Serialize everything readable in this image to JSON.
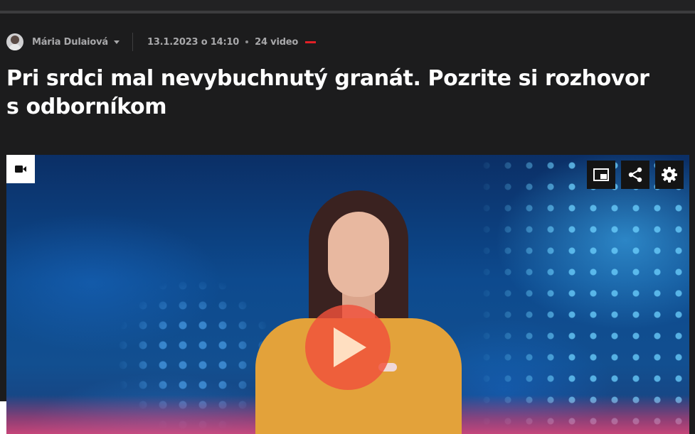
{
  "colors": {
    "background": "#1c1c1d",
    "headline": "#ffffff",
    "meta_text": "#a8a8aa",
    "accent_red": "#e12026",
    "play_button": "#f0503c"
  },
  "meta": {
    "author": "Mária Dulaiová",
    "date": "13.1.2023 o 14:10",
    "video_count": "24 video"
  },
  "article": {
    "title": "Pri srdci mal nevybuchnutý granát. Pozrite si rozhovor s odborníkom"
  },
  "player": {
    "badge_icon": "video-camera-icon",
    "controls": [
      {
        "icon": "picture-in-picture-icon"
      },
      {
        "icon": "share-icon"
      },
      {
        "icon": "gear-icon"
      }
    ],
    "play_icon": "play-icon"
  }
}
